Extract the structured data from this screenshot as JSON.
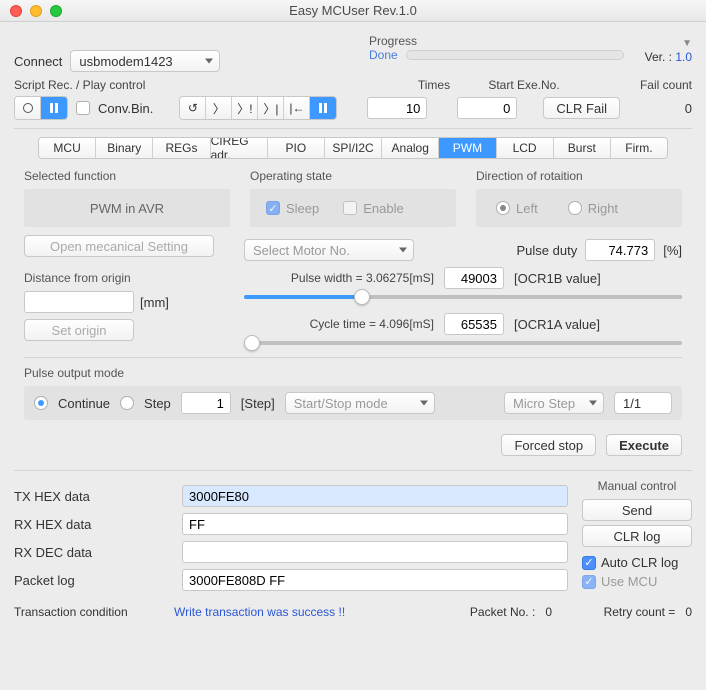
{
  "window_title": "Easy MCUser Rev.1.0",
  "connect": {
    "label": "Connect",
    "value": "usbmodem1423"
  },
  "progress": {
    "label": "Progress",
    "status": "Done"
  },
  "version": {
    "label": "Ver. : ",
    "value": "1.0"
  },
  "script": {
    "header": "Script Rec. / Play control",
    "conv_bin": "Conv.Bin.",
    "glyph_loop": "↺",
    "glyph_step": "〉",
    "glyph_step_bang": "〉!",
    "glyph_end": "〉|",
    "glyph_rewind": "|←",
    "times_label": "Times",
    "times_value": "10",
    "start_exe_label": "Start Exe.No.",
    "start_exe_value": "0",
    "clr_fail": "CLR Fail",
    "fail_count_label": "Fail count",
    "fail_count": "0"
  },
  "tabs": [
    "MCU",
    "Binary",
    "REGs",
    "CIREG adr.",
    "PIO",
    "SPI/I2C",
    "Analog",
    "PWM",
    "LCD",
    "Burst",
    "Firm."
  ],
  "pwm": {
    "selected_fn_label": "Selected function",
    "selected_fn": "PWM in AVR",
    "op_state_label": "Operating state",
    "sleep": "Sleep",
    "enable": "Enable",
    "dir_label": "Direction of rotaition",
    "left": "Left",
    "right": "Right",
    "open_mech": "Open mecanical Setting",
    "select_motor": "Select Motor No.",
    "pulse_duty_label": "Pulse duty",
    "pulse_duty_value": "74.773",
    "pulse_duty_unit": "[%]",
    "dist_label": "Distance from origin",
    "dist_unit": "[mm]",
    "set_origin": "Set origin",
    "pulse_width_label": "Pulse width = 3.06275[mS]",
    "pulse_width_value": "49003",
    "ocr1b": "[OCR1B value]",
    "cycle_time_label": "Cycle time = 4.096[mS]",
    "cycle_time_value": "65535",
    "ocr1a": "[OCR1A value]",
    "pulse_output_label": "Pulse output mode",
    "continue": "Continue",
    "step": "Step",
    "step_value": "1",
    "step_unit": "[Step]",
    "start_stop": "Start/Stop mode",
    "micro_step": "Micro Step",
    "ratio": "1/1",
    "forced_stop": "Forced stop",
    "execute": "Execute"
  },
  "hex": {
    "tx_label": "TX HEX data",
    "tx_value": "3000FE80",
    "rx_label": "RX HEX data",
    "rx_value": "FF",
    "rx_dec_label": "RX DEC data",
    "rx_dec_value": "",
    "packet_log_label": "Packet log",
    "packet_log_value": "3000FE808D FF"
  },
  "manual": {
    "label": "Manual control",
    "send": "Send",
    "clr_log": "CLR log",
    "auto_clr": "Auto CLR log",
    "use_mcu": "Use MCU"
  },
  "footer": {
    "txn_label": "Transaction condition",
    "txn_msg": "Write transaction was success !!",
    "packet_no_label": "Packet No. :",
    "packet_no": "0",
    "retry_label": "Retry count  =",
    "retry": "0"
  }
}
